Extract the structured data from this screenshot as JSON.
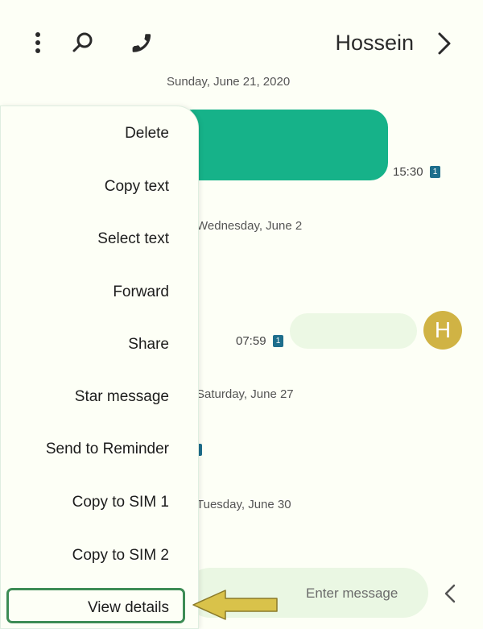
{
  "header": {
    "title": "Hossein",
    "icons": [
      "back-arrow-icon",
      "phone-icon",
      "search-icon",
      "more-vert-icon"
    ]
  },
  "conversation": {
    "dates": [
      "Sunday, June 21, 2020",
      "Wednesday, June 2",
      "Saturday, June 27",
      "Tuesday, June 30"
    ],
    "outgoing_time": "15:30",
    "incoming_time": "07:59",
    "sim_badge": "1",
    "avatar_letter": "H"
  },
  "composer": {
    "placeholder": "Enter message"
  },
  "context_menu": {
    "items": [
      "Delete",
      "Copy text",
      "Select text",
      "Forward",
      "Share",
      "Star message",
      "Send to Reminder",
      "Copy to SIM 1",
      "Copy to SIM 2",
      "View details"
    ]
  },
  "colors": {
    "accent_green": "#16b289",
    "highlight_border": "#3d8c55",
    "avatar_bg": "#d0b344",
    "arrow_fill": "#d9c24a"
  }
}
